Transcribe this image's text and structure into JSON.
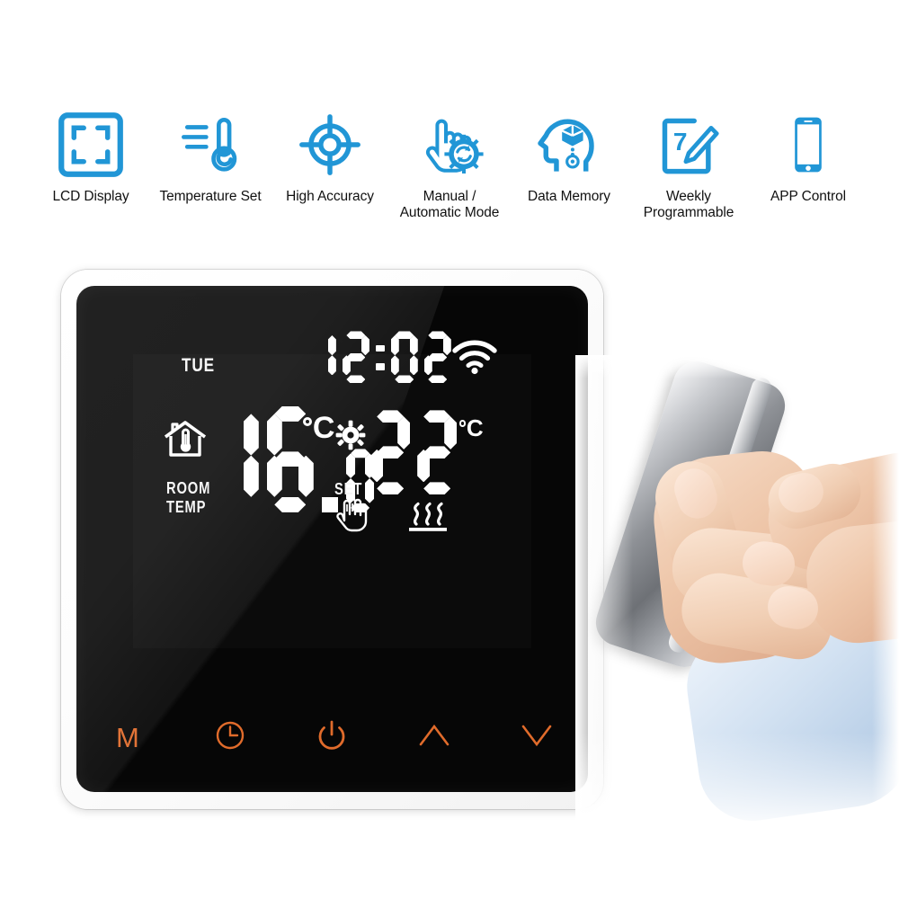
{
  "page": {
    "background_color": "#FFFFFF",
    "accent_blue": "#2196D6",
    "button_orange": "#E06B2B"
  },
  "features": [
    {
      "label": "LCD Display",
      "icon": "lcd-display-icon"
    },
    {
      "label": "Temperature Set",
      "icon": "thermometer-icon"
    },
    {
      "label": "High Accuracy",
      "icon": "crosshair-target-icon"
    },
    {
      "label": "Manual /\nAutomatic Mode",
      "icon": "hand-gear-icon"
    },
    {
      "label": "Data Memory",
      "icon": "head-memory-icon"
    },
    {
      "label": "Weekly\nProgrammable",
      "icon": "calendar-seven-pencil-icon"
    },
    {
      "label": "APP Control",
      "icon": "smartphone-icon"
    }
  ],
  "device": {
    "name": "Smart WiFi Thermostat",
    "bezel_color": "#FFFFFF",
    "glass_color": "#060606",
    "lcd": {
      "weekday": "TUE",
      "clock": "12:02",
      "clock_digits": [
        "1",
        "2",
        "0",
        "2"
      ],
      "wifi_icon": "wifi-icon",
      "room_temp_icon": "house-thermometer-icon",
      "room_temp_label": "ROOM\nTEMP",
      "room_temperature": "16.0",
      "room_temp_digits": [
        "1",
        "6",
        "0"
      ],
      "room_temp_unit": "C",
      "set_icon": "gear-icon",
      "set_label": "SET",
      "set_temperature": "22",
      "set_temp_digits": [
        "2",
        "2"
      ],
      "set_temp_unit": "C",
      "mode_icon": "manual-hand-icon",
      "heating_icon": "floor-heating-icon"
    },
    "buttons": [
      {
        "name": "mode-button",
        "label": "M",
        "icon": "letter-m"
      },
      {
        "name": "clock-button",
        "label": "",
        "icon": "clock-icon"
      },
      {
        "name": "power-button",
        "label": "",
        "icon": "power-icon"
      },
      {
        "name": "up-button",
        "label": "",
        "icon": "chevron-up-icon"
      },
      {
        "name": "down-button",
        "label": "",
        "icon": "chevron-down-icon"
      }
    ]
  },
  "photo": {
    "description": "Hand holding smartphone",
    "shirt_cuff_color": "#C4D8EE"
  }
}
